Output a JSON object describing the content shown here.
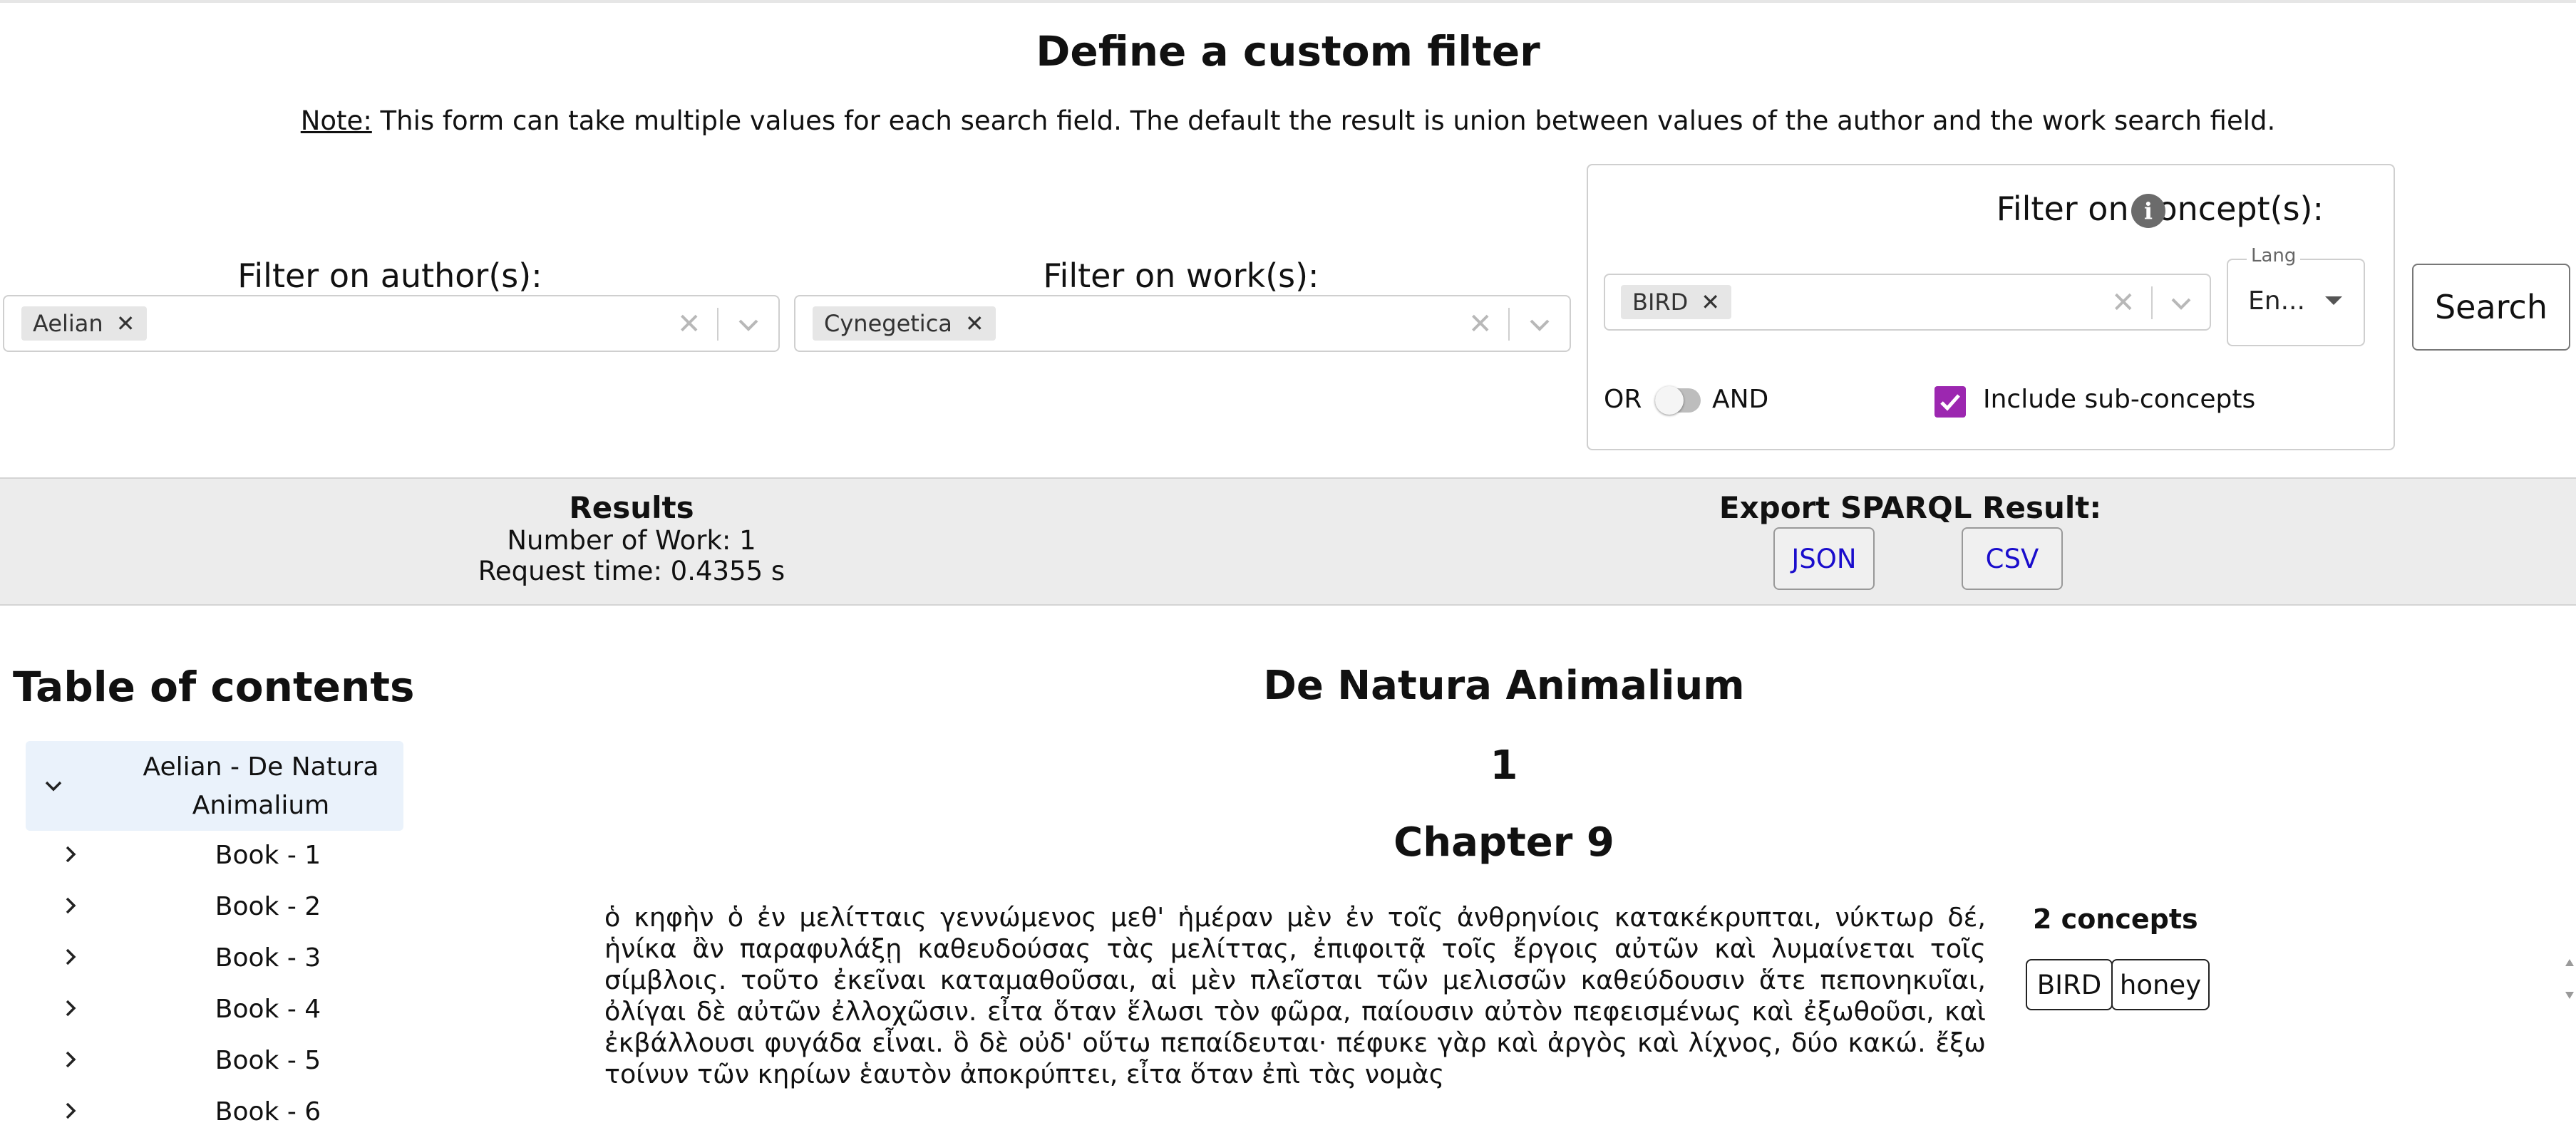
{
  "header": {
    "title": "Define a custom filter",
    "note_label": "Note:",
    "note_text": " This form can take multiple values for each search field. The default the result is union between values of the author and the work search field."
  },
  "author_filter": {
    "label": "Filter on author(s):",
    "tags": [
      "Aelian"
    ]
  },
  "work_filter": {
    "label": "Filter on work(s):",
    "tags": [
      "Cynegetica"
    ]
  },
  "concept_filter": {
    "label": "Filter on concept(s):",
    "info_icon": "i",
    "tags": [
      "BIRD"
    ],
    "lang_legend": "Lang",
    "lang_value": "En...",
    "toggle_or": "OR",
    "toggle_and": "AND",
    "toggle_state": "OR",
    "include_subconcepts_label": "Include sub-concepts",
    "include_subconcepts_checked": true
  },
  "search_button": "Search",
  "results": {
    "title": "Results",
    "work_count": "Number of Work: 1",
    "request_time": "Request time: 0.4355 s",
    "export_title": "Export SPARQL Result:",
    "export_json": "JSON",
    "export_csv": "CSV"
  },
  "toc": {
    "title": "Table of contents",
    "root": "Aelian - De Natura Animalium",
    "items": [
      "Book - 1",
      "Book - 2",
      "Book - 3",
      "Book - 4",
      "Book - 5",
      "Book - 6"
    ]
  },
  "content": {
    "work_title": "De Natura Animalium",
    "book_number": "1",
    "chapter": "Chapter 9",
    "passage": "ὁ κηφὴν ὁ ἐν μελίτταις γεννώμενος μεθ' ἡμέραν μὲν ἐν τοῖς ἀνθρηνίοις κατακέκρυπται, νύκτωρ δέ, ἡνίκα ἂν παραφυλάξῃ καθευδούσας τὰς μελίττας, ἐπιφοιτᾷ τοῖς ἔργοις αὐτῶν καὶ λυμαίνεται τοῖς σίμβλοις. τοῦτο ἐκεῖναι καταμαθοῦσαι, αἱ μὲν πλεῖσται τῶν μελισσῶν καθεύδουσιν ἅτε πεπονηκυῖαι, ὀλίγαι δὲ αὐτῶν ἐλλοχῶσιν. εἶτα ὅταν ἕλωσι τὸν φῶρα, παίουσιν αὐτὸν πεφεισμένως καὶ ἐξωθοῦσι, καὶ ἐκβάλλουσι φυγάδα εἶναι. ὃ δὲ οὐδ' οὕτω πεπαίδευται· πέφυκε γὰρ καὶ ἀργὸς καὶ λίχνος, δύο κακώ. ἔξω τοίνυν τῶν κηρίων ἑαυτὸν ἀποκρύπτει, εἶτα ὅταν ἐπὶ τὰς νομὰς",
    "concepts_count": "2 concepts",
    "concepts": [
      "BIRD",
      "honey"
    ]
  },
  "colors": {
    "checkbox": "#9c27b0",
    "link": "#1a0dcc",
    "band": "#ececec",
    "toc_highlight": "#eaf2fb"
  }
}
